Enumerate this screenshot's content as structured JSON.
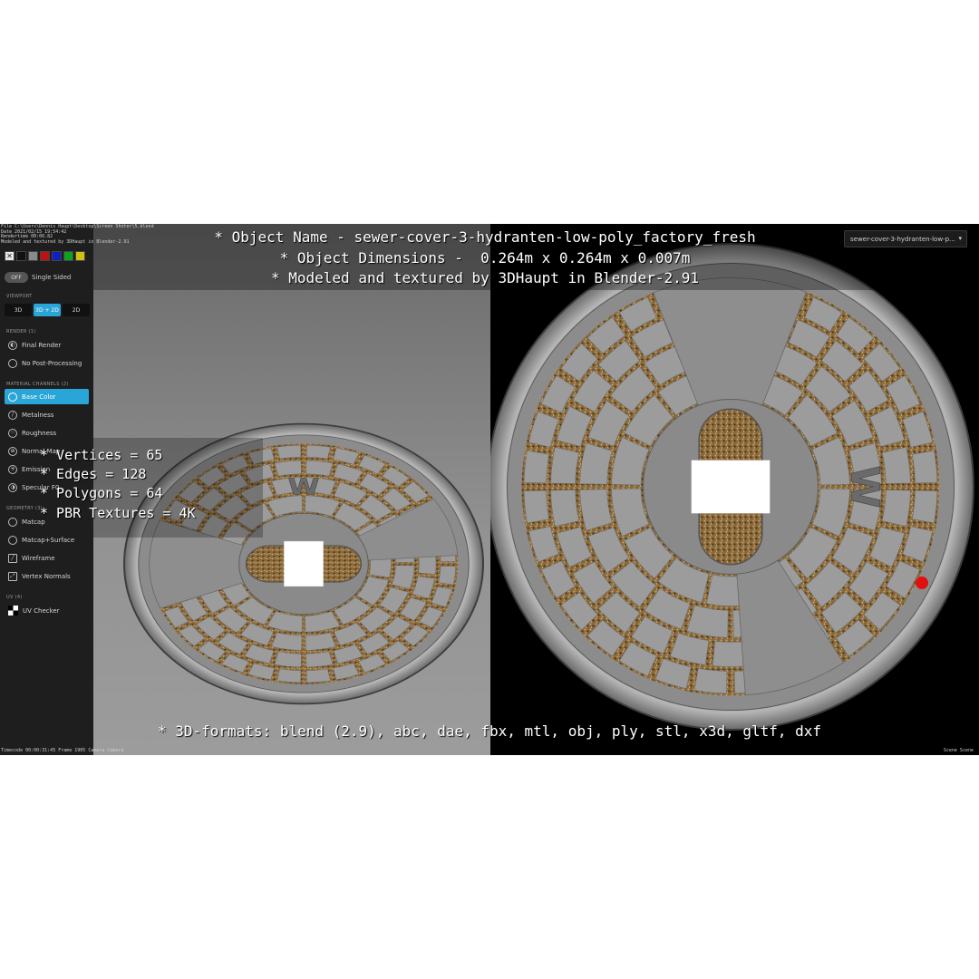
{
  "overlay": {
    "line1": "* Object Name - sewer-cover-3-hydranten-low-poly_factory_fresh",
    "line2": "* Object Dimensions -  0.264m x 0.264m x 0.007m",
    "line3": "* Modeled and textured by 3DHaupt in Blender-2.91",
    "stats": [
      "* Vertices = 65",
      "* Edges = 128",
      "* Polygons = 64",
      "* PBR Textures = 4K"
    ],
    "formats": "* 3D-formats: blend (2.9), abc, dae, fbx, mtl, obj, ply, stl, x3d, gltf, dxf"
  },
  "file_info": [
    "File C:\\Users\\Dennis Haupt\\Desktop\\Screen Shoter\\5.blend",
    "Date 2021/02/15 19:54:42",
    "Rendertime 00:00.82",
    "Modeled and textured by 3DHaupt in Blender-2.91"
  ],
  "sidebar": {
    "swatch_colors": [
      "#e8e8e8",
      "#111111",
      "#8a8a8a",
      "#c01010",
      "#1020c0",
      "#10a020",
      "#d0c010"
    ],
    "single_sided": {
      "toggle": "OFF",
      "label": "Single Sided"
    },
    "viewport": {
      "title": "VIEWPORT",
      "options": [
        "3D",
        "3D + 2D",
        "2D"
      ],
      "active": "3D + 2D"
    },
    "render": {
      "title": "RENDER (1)",
      "items": [
        "Final Render",
        "No Post-Processing"
      ]
    },
    "material": {
      "title": "MATERIAL CHANNELS (2)",
      "items": [
        "Base Color",
        "Metalness",
        "Roughness",
        "Normal Map",
        "Emission",
        "Specular F0"
      ],
      "active": "Base Color"
    },
    "geometry": {
      "title": "GEOMETRY (3)",
      "items": [
        "Matcap",
        "Matcap+Surface",
        "Wireframe",
        "Vertex Normals"
      ]
    },
    "uv": {
      "title": "UV (4)",
      "items": [
        "UV Checker"
      ]
    }
  },
  "object_dropdown": "sewer-cover-3-hydranten-low-p...",
  "cover_letter": "W",
  "status": {
    "left": "Timecode 00:00:31:45    Frame 1905    Camera Camera",
    "right": "Scene Scene"
  },
  "colors": {
    "accent": "#2aa5d8",
    "marker": "#e01010"
  }
}
